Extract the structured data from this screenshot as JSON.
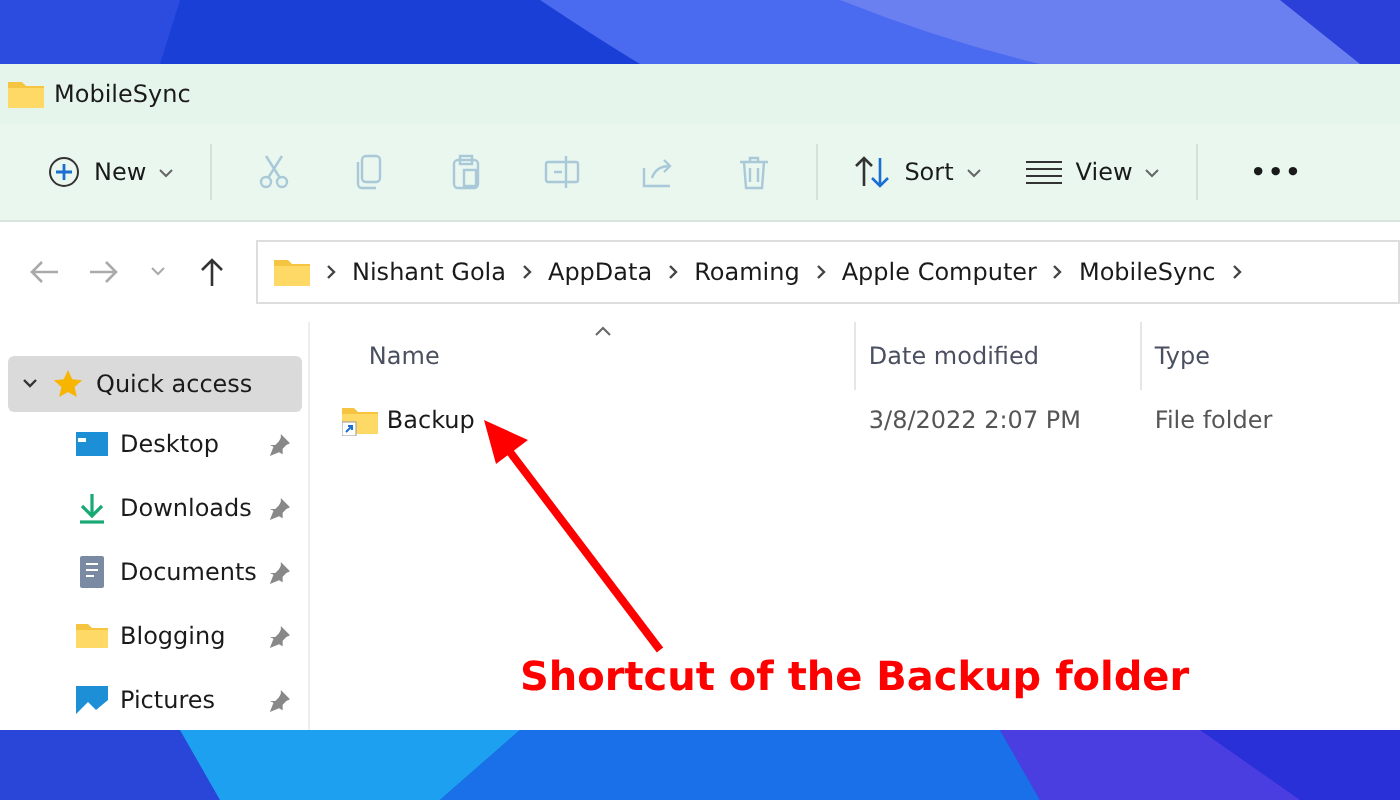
{
  "window": {
    "title": "MobileSync"
  },
  "toolbar": {
    "new_button": {
      "label": "New"
    },
    "icon_buttons": [
      {
        "disabled": true
      },
      {
        "disabled": true
      },
      {
        "disabled": true
      },
      {
        "disabled": true
      },
      {
        "disabled": true
      },
      {
        "disabled": true
      }
    ],
    "sort_button": {
      "label": "Sort"
    },
    "view_button": {
      "label": "View"
    },
    "more_button": {
      "label": "•••"
    }
  },
  "navigation": {
    "back_disabled": true,
    "forward_disabled": true
  },
  "breadcrumb": [
    "Nishant Gola",
    "AppData",
    "Roaming",
    "Apple Computer",
    "MobileSync"
  ],
  "sidebar": {
    "label": "Quick access",
    "expanded": true,
    "selected": true,
    "children": [
      {
        "label": "Desktop",
        "pinned": true
      },
      {
        "label": "Downloads",
        "pinned": true
      },
      {
        "label": "Documents",
        "pinned": true
      },
      {
        "label": "Blogging",
        "pinned": true
      },
      {
        "label": "Pictures",
        "pinned": true
      }
    ]
  },
  "table": {
    "columns": [
      {
        "label": "Name",
        "sorted": true
      },
      {
        "label": "Date modified",
        "sorted": false
      },
      {
        "label": "Type",
        "sorted": false
      }
    ],
    "rows": [
      {
        "name": "Backup",
        "date_modified": "3/8/2022 2:07 PM",
        "type": "File folder",
        "shortcut": true
      }
    ]
  },
  "annotation": {
    "text": "Shortcut of the Backup folder"
  }
}
